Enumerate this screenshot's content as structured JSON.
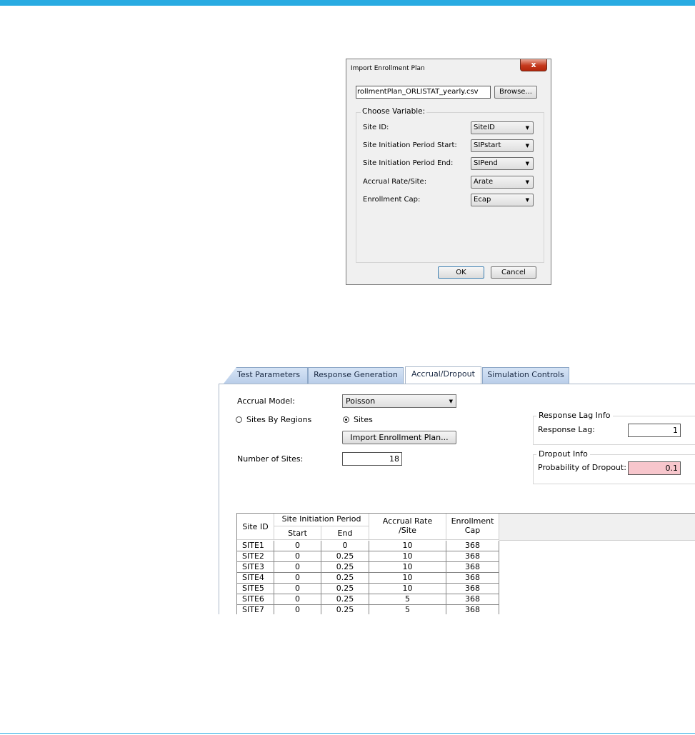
{
  "dialog": {
    "title": "Import Enrollment Plan",
    "close_label": "x",
    "file_path": "rollmentPlan_ORLISTAT_yearly.csv",
    "browse_label": "Browse...",
    "choose_variable_label": "Choose Variable:",
    "variables": [
      {
        "label": "Site ID:",
        "value": "SiteID"
      },
      {
        "label": "Site Initiation Period Start:",
        "value": "SIPstart"
      },
      {
        "label": "Site Initiation Period End:",
        "value": "SIPend"
      },
      {
        "label": "Accrual Rate/Site:",
        "value": "Arate"
      },
      {
        "label": "Enrollment Cap:",
        "value": "Ecap"
      }
    ],
    "ok_label": "OK",
    "cancel_label": "Cancel"
  },
  "tabs": [
    {
      "label": "Test Parameters"
    },
    {
      "label": "Response Generation"
    },
    {
      "label": "Accrual/Dropout"
    },
    {
      "label": "Simulation Controls"
    }
  ],
  "accrual": {
    "model_label": "Accrual Model:",
    "model_value": "Poisson",
    "radio_regions_label": "Sites By Regions",
    "radio_sites_label": "Sites",
    "import_button_label": "Import Enrollment Plan...",
    "num_sites_label": "Number of Sites:",
    "num_sites_value": "18"
  },
  "response_lag": {
    "group_label": "Response Lag Info",
    "label": "Response Lag:",
    "value": "1"
  },
  "dropout": {
    "group_label": "Dropout Info",
    "label": "Probability of Dropout:",
    "value": "0.1"
  },
  "table": {
    "header": {
      "site_id": "Site ID",
      "period": "Site Initiation Period",
      "start": "Start",
      "end": "End",
      "rate_line1": "Accrual Rate",
      "rate_line2": "/Site",
      "cap_line1": "Enrollment",
      "cap_line2": "Cap"
    },
    "rows": [
      [
        "SITE1",
        "0",
        "0",
        "10",
        "368"
      ],
      [
        "SITE2",
        "0",
        "0.25",
        "10",
        "368"
      ],
      [
        "SITE3",
        "0",
        "0.25",
        "10",
        "368"
      ],
      [
        "SITE4",
        "0",
        "0.25",
        "10",
        "368"
      ],
      [
        "SITE5",
        "0",
        "0.25",
        "10",
        "368"
      ],
      [
        "SITE6",
        "0",
        "0.25",
        "5",
        "368"
      ],
      [
        "SITE7",
        "0",
        "0.25",
        "5",
        "368"
      ]
    ]
  },
  "colors": {
    "accent_bar": "#29abe2",
    "dropout_field_bg": "#f7c6cc"
  }
}
